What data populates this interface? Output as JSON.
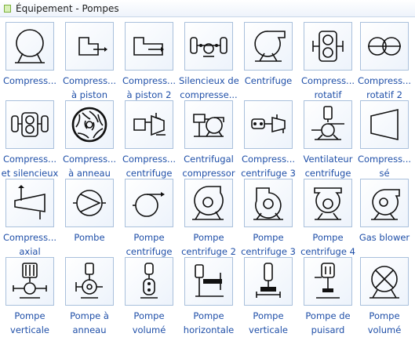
{
  "title": "Équipement  - Pompes",
  "items": [
    {
      "icon": "compressor-icon",
      "line1": "Compress...",
      "line2": ""
    },
    {
      "icon": "piston-compressor-icon",
      "line1": "Compress...",
      "line2": "à piston"
    },
    {
      "icon": "piston-compressor-2-icon",
      "line1": "Compress...",
      "line2": "à piston 2"
    },
    {
      "icon": "compressor-silencer-icon",
      "line1": "Silencieux de",
      "line2": "compresse..."
    },
    {
      "icon": "centrifugal-icon",
      "line1": "Centrifuge",
      "line2": ""
    },
    {
      "icon": "rotary-compressor-icon",
      "line1": "Compress...",
      "line2": "rotatif"
    },
    {
      "icon": "rotary-compressor-2-icon",
      "line1": "Compress...",
      "line2": "rotatif 2"
    },
    {
      "icon": "compressor-with-silencers-icon",
      "line1": "Compress...",
      "line2": "et silencieux"
    },
    {
      "icon": "ring-compressor-icon",
      "line1": "Compress...",
      "line2": "à anneau"
    },
    {
      "icon": "centrifugal-compressor-icon",
      "line1": "Compress...",
      "line2": "centrifuge"
    },
    {
      "icon": "centrifugal-compressor-alt-icon",
      "line1": "Centrifugal",
      "line2": "compressor"
    },
    {
      "icon": "centrifugal-compressor-3-icon",
      "line1": "Compress...",
      "line2": "centrifuge 3"
    },
    {
      "icon": "centrifugal-fan-icon",
      "line1": "Ventilateur",
      "line2": "centrifuge"
    },
    {
      "icon": "compressor-alt-icon",
      "line1": "Compress...",
      "line2": "sé"
    },
    {
      "icon": "axial-compressor-icon",
      "line1": "Compress...",
      "line2": "axial"
    },
    {
      "icon": "pump-icon",
      "line1": "Pombe",
      "line2": ""
    },
    {
      "icon": "centrifugal-pump-icon",
      "line1": "Pompe",
      "line2": "centrifuge"
    },
    {
      "icon": "centrifugal-pump-2-icon",
      "line1": "Pompe",
      "line2": "centrifuge 2"
    },
    {
      "icon": "centrifugal-pump-3-icon",
      "line1": "Pompe",
      "line2": "centrifuge 3"
    },
    {
      "icon": "centrifugal-pump-4-icon",
      "line1": "Pompe",
      "line2": "centrifuge 4"
    },
    {
      "icon": "gas-blower-icon",
      "line1": "Gas blower",
      "line2": ""
    },
    {
      "icon": "vertical-pump-icon",
      "line1": "Pompe",
      "line2": "verticale"
    },
    {
      "icon": "ring-pump-icon",
      "line1": "Pompe à",
      "line2": "anneau"
    },
    {
      "icon": "volumetric-pump-icon",
      "line1": "Pompe",
      "line2": "volumé"
    },
    {
      "icon": "horizontal-pump-icon",
      "line1": "Pompe",
      "line2": "horizontale"
    },
    {
      "icon": "vertical-pump-2-icon",
      "line1": "Pompe",
      "line2": "verticale"
    },
    {
      "icon": "sump-pump-icon",
      "line1": "Pompe de",
      "line2": "puisard"
    },
    {
      "icon": "volumetric-pump-2-icon",
      "line1": "Pompe",
      "line2": "volumé"
    }
  ]
}
